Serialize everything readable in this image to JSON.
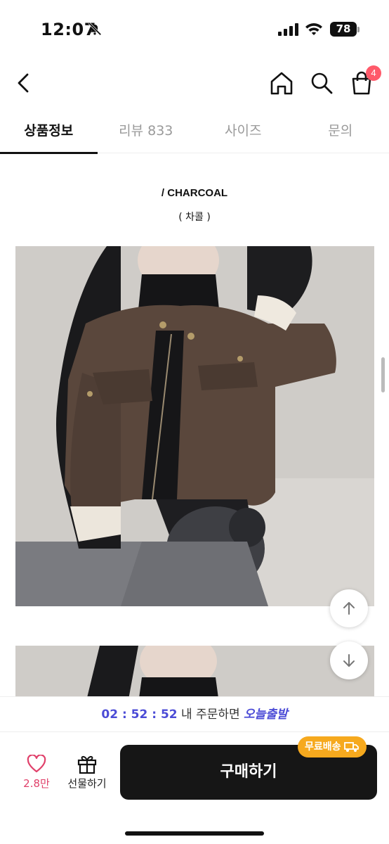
{
  "status_bar": {
    "time": "12:07",
    "battery": "78"
  },
  "header": {
    "cart_count": "4"
  },
  "tabs": [
    {
      "label": "상품정보",
      "active": true
    },
    {
      "label": "리뷰 833",
      "active": false
    },
    {
      "label": "사이즈",
      "active": false
    },
    {
      "label": "문의",
      "active": false
    }
  ],
  "product": {
    "color_name": "/ CHARCOAL",
    "color_sub": "( 차콜 )"
  },
  "notice": {
    "countdown": "02 : 52 : 52",
    "text": "내 주문하면",
    "highlight": "오늘출발"
  },
  "bottom": {
    "like_count": "2.8만",
    "gift_label": "선물하기",
    "buy_label": "구매하기",
    "free_shipping": "무료배송"
  },
  "colors": {
    "accent": "#4b4bd6",
    "badge": "#ff5a6a",
    "buy": "#161616",
    "free_ship": "#f6a91e",
    "heart": "#e0406a"
  }
}
